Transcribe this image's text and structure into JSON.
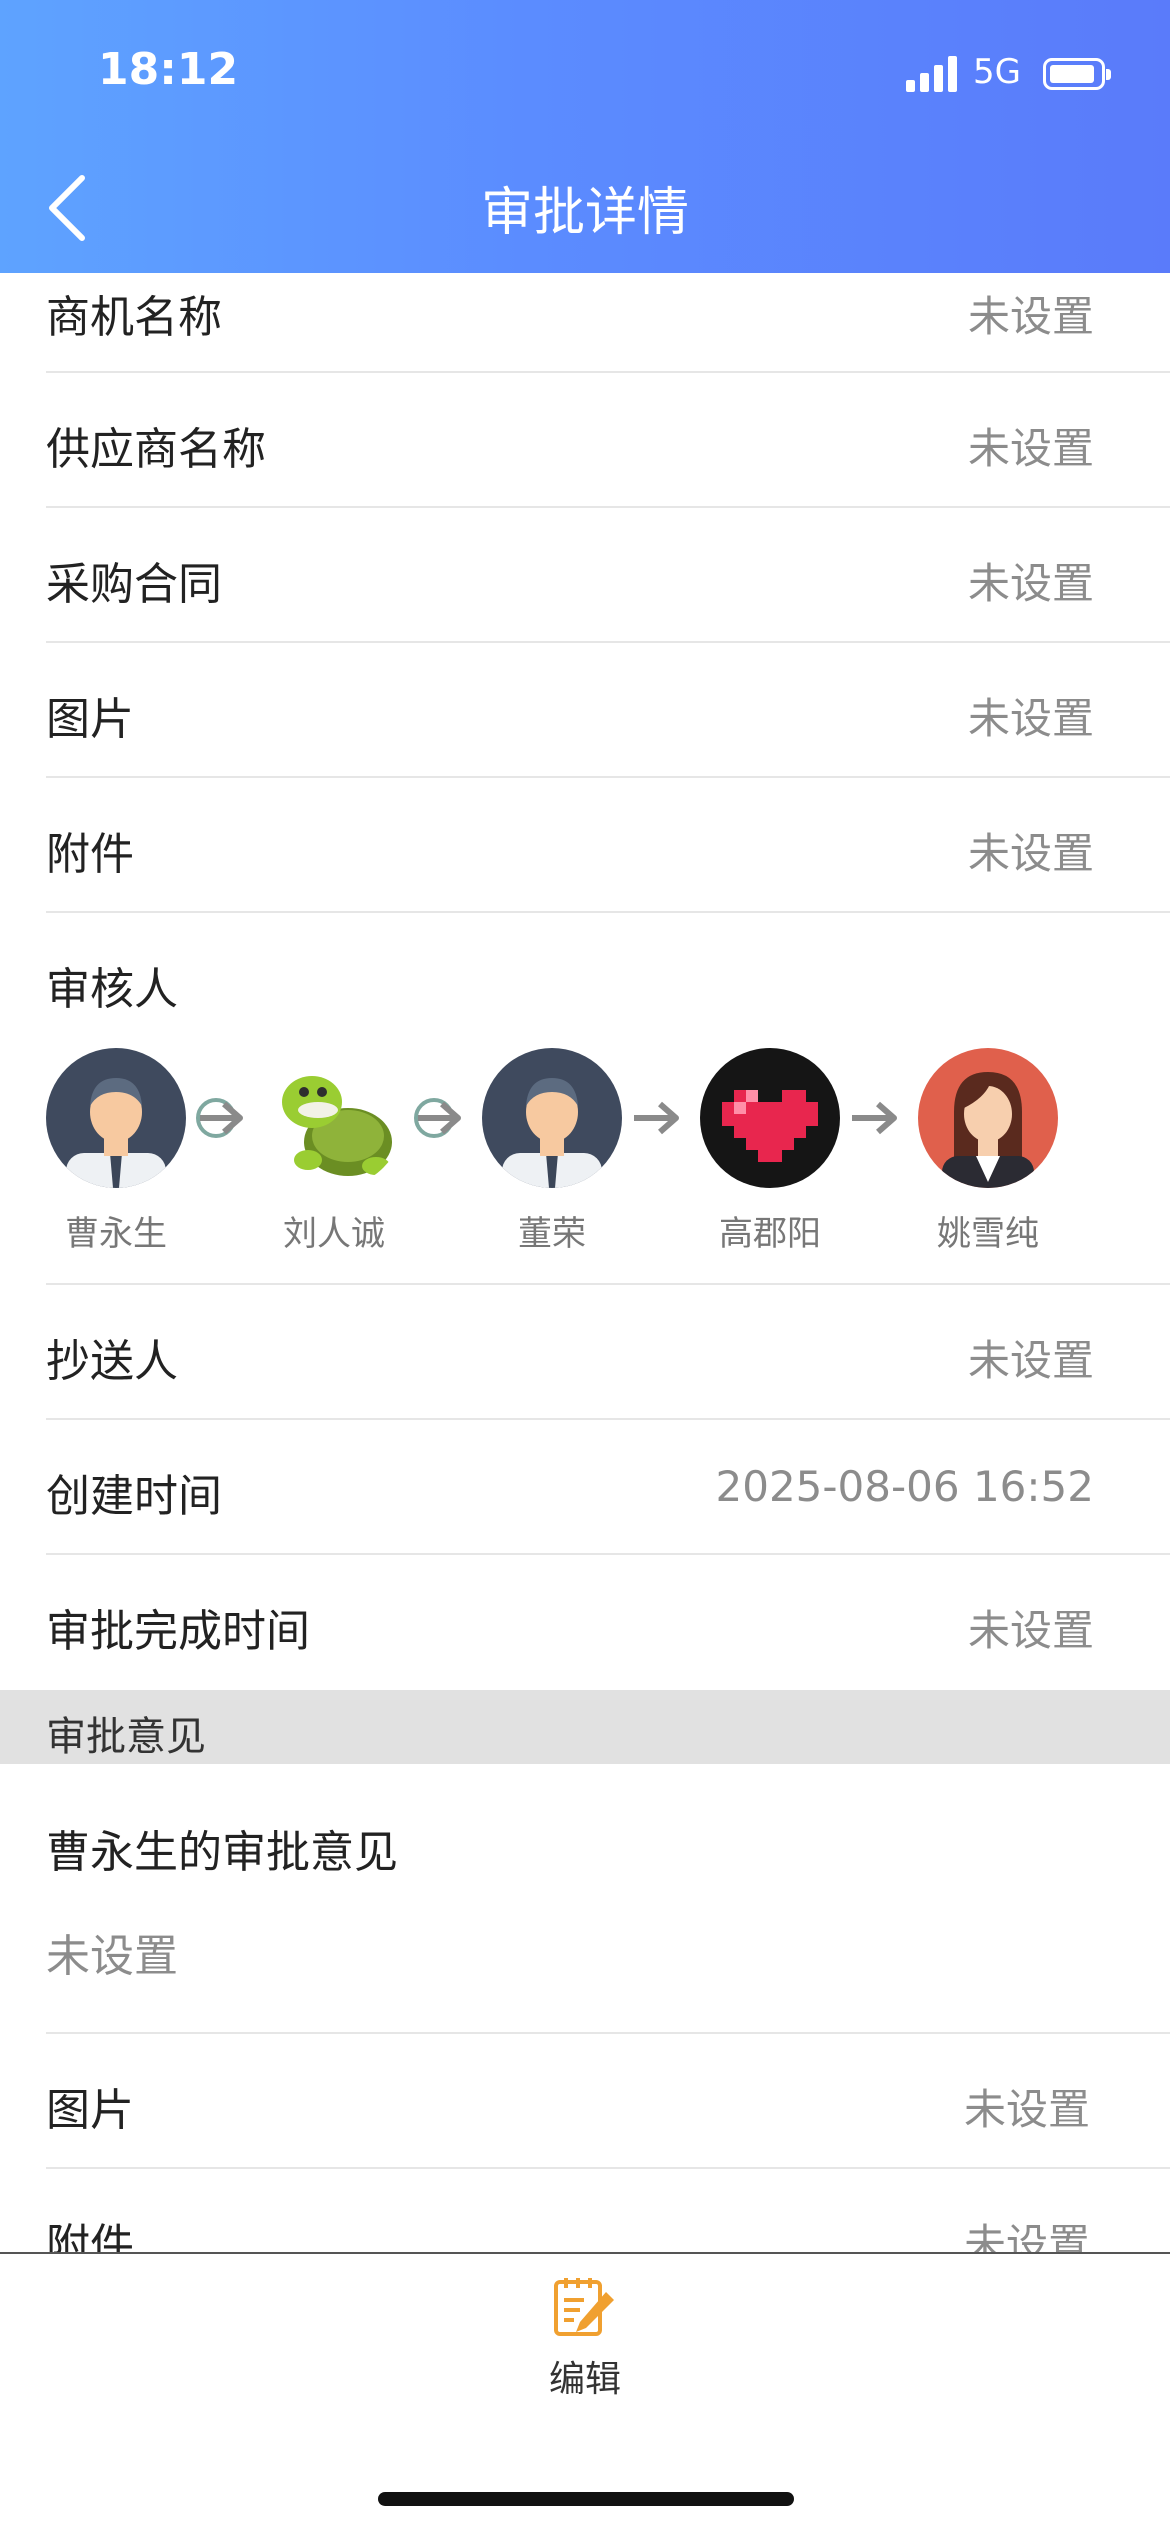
{
  "status_bar": {
    "time": "18:12",
    "network": "5G"
  },
  "header": {
    "title": "审批详情"
  },
  "fields": [
    {
      "label": "商机名称",
      "value": "未设置"
    },
    {
      "label": "供应商名称",
      "value": "未设置"
    },
    {
      "label": "采购合同",
      "value": "未设置"
    },
    {
      "label": "图片",
      "value": "未设置"
    },
    {
      "label": "附件",
      "value": "未设置"
    }
  ],
  "approvers": {
    "label": "审核人",
    "people": [
      {
        "name": "曹永生",
        "avatar": "male-avatar-icon"
      },
      {
        "name": "刘人诚",
        "avatar": "turtle-avatar-icon"
      },
      {
        "name": "董荣",
        "avatar": "male-avatar-icon"
      },
      {
        "name": "高郡阳",
        "avatar": "pixel-heart-avatar-icon"
      },
      {
        "name": "姚雪纯",
        "avatar": "female-avatar-icon"
      }
    ]
  },
  "fields2": [
    {
      "label": "抄送人",
      "value": "未设置"
    },
    {
      "label": "创建时间",
      "value": "2025-08-06 16:52"
    },
    {
      "label": "审批完成时间",
      "value": "未设置"
    }
  ],
  "opinions": {
    "section_title": "审批意见",
    "title": "曹永生的审批意见",
    "text": "未设置",
    "fields": [
      {
        "label": "图片",
        "value": "未设置"
      },
      {
        "label": "附件",
        "value": "未设置"
      }
    ]
  },
  "footer": {
    "edit_label": "编辑"
  },
  "colors": {
    "header_start": "#5ea3ff",
    "header_end": "#5a7bfa",
    "edit_icon": "#f0a030"
  }
}
